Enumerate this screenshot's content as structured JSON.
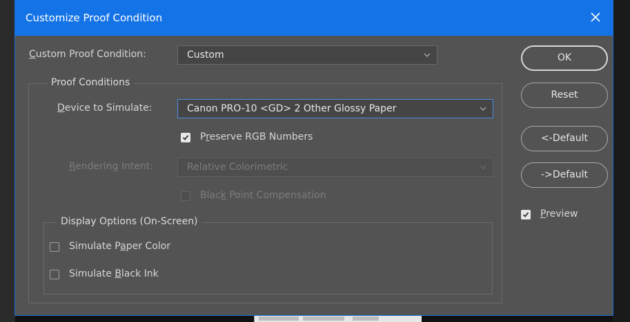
{
  "dialog": {
    "title": "Customize Proof Condition"
  },
  "custom_proof": {
    "label": "Custom Proof Condition:",
    "value": "Custom"
  },
  "proof_conditions": {
    "group_label": "Proof Conditions",
    "device_label": "Device to Simulate:",
    "device_value": "Canon PRO-10 <GD> 2 Other Glossy Paper",
    "preserve_rgb_label": "Preserve RGB Numbers",
    "preserve_rgb_checked": true,
    "rendering_intent_label": "Rendering Intent:",
    "rendering_intent_value": "Relative Colorimetric",
    "black_point_label": "Black Point Compensation",
    "black_point_checked": false
  },
  "display_options": {
    "group_label": "Display Options (On-Screen)",
    "paper_color_label": "Simulate Paper Color",
    "paper_color_checked": false,
    "black_ink_label": "Simulate Black Ink",
    "black_ink_checked": false
  },
  "buttons": {
    "ok": "OK",
    "reset": "Reset",
    "load_default": "<-Default",
    "save_default": "->Default"
  },
  "preview": {
    "label": "Preview",
    "checked": true
  },
  "colors": {
    "title_bar": "#1473e6",
    "dialog_bg": "#535353",
    "focus_border": "#4c8de6"
  },
  "icons": {
    "close": "close-icon",
    "dropdown": "chevron-down-icon",
    "check": "checkmark-icon"
  }
}
